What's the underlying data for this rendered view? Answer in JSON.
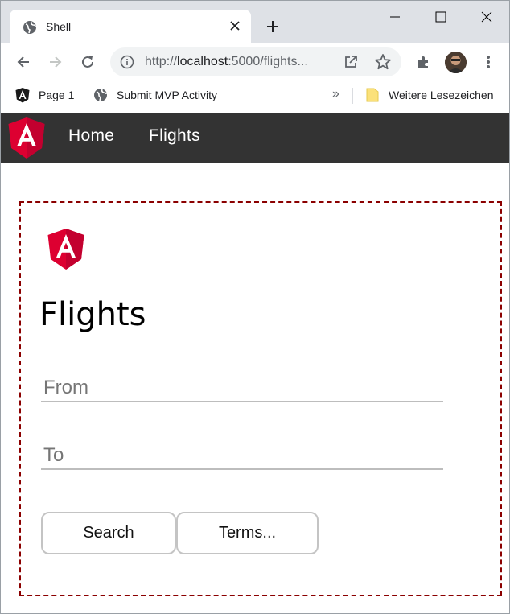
{
  "browser": {
    "tab_title": "Shell",
    "url_prefix": "http://",
    "url_host": "localhost",
    "url_rest": ":5000/flights...",
    "bookmarks": [
      {
        "label": "Page 1",
        "icon": "angular-icon"
      },
      {
        "label": "Submit MVP Activity",
        "icon": "globe-icon"
      }
    ],
    "more_bookmarks": "»",
    "other_bookmarks_label": "Weitere Lesezeichen"
  },
  "navbar": {
    "links": [
      "Home",
      "Flights"
    ]
  },
  "page": {
    "title": "Flights",
    "from_placeholder": "From",
    "to_placeholder": "To",
    "search_label": "Search",
    "terms_label": "Terms..."
  },
  "colors": {
    "angular_red": "#dd0031",
    "navbar_bg": "#333333",
    "card_border": "#8b0000"
  }
}
